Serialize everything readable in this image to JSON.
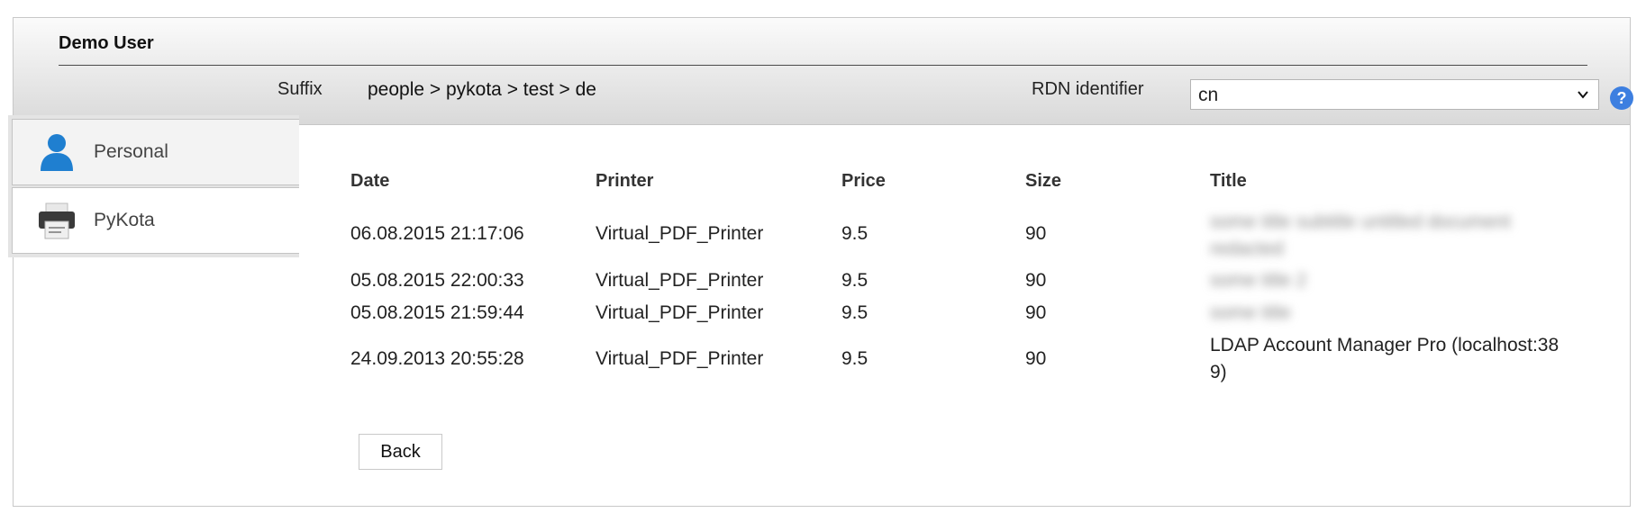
{
  "header": {
    "title": "Demo User",
    "suffix_label": "Suffix",
    "suffix_value": "people > pykota > test > de",
    "rdn_label": "RDN identifier",
    "rdn_value": "cn",
    "help_glyph": "?"
  },
  "tabs": [
    {
      "label": "Personal",
      "icon": "person-icon",
      "active": false
    },
    {
      "label": "PyKota",
      "icon": "printer-icon",
      "active": true
    }
  ],
  "table": {
    "columns": [
      "Date",
      "Printer",
      "Price",
      "Size",
      "Title"
    ],
    "rows": [
      {
        "date": "06.08.2015 21:17:06",
        "printer": "Virtual_PDF_Printer",
        "price": "9.5",
        "size": "90",
        "title": "some title subtitle untitled document redacted"
      },
      {
        "date": "05.08.2015 22:00:33",
        "printer": "Virtual_PDF_Printer",
        "price": "9.5",
        "size": "90",
        "title": "some title 2"
      },
      {
        "date": "05.08.2015 21:59:44",
        "printer": "Virtual_PDF_Printer",
        "price": "9.5",
        "size": "90",
        "title": "some title"
      },
      {
        "date": "24.09.2013 20:55:28",
        "printer": "Virtual_PDF_Printer",
        "price": "9.5",
        "size": "90",
        "title": "LDAP Account Manager Pro (localhost:389)"
      }
    ]
  },
  "back_label": "Back",
  "colors": {
    "accent": "#3d7fe0",
    "person_icon": "#1f7fd0"
  }
}
